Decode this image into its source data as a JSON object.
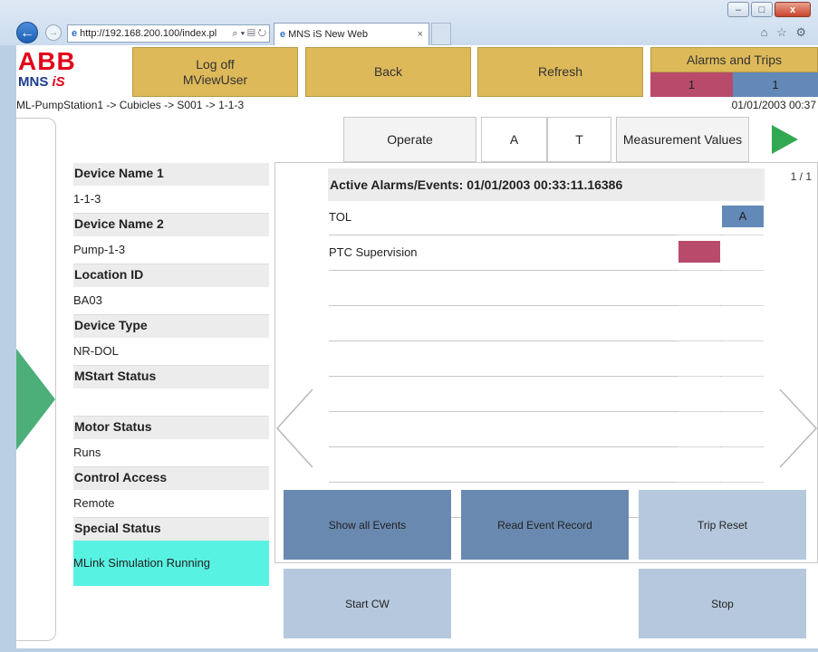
{
  "browser": {
    "address": "http://192.168.200.100/index.pl",
    "address_tools": "⌕ ▾ ▤ ↻",
    "tab_title": "MNS iS New Web",
    "tab_close": "×",
    "ie_glyph": "e",
    "back_glyph": "←",
    "forward_glyph": "→",
    "window_buttons": [
      "–",
      "□",
      "x"
    ],
    "toolbar_icons": "⌂ ☆ ⚙"
  },
  "logo": {
    "brand": "ABB",
    "product_main": "MNS ",
    "product_accent": "iS"
  },
  "header": {
    "logoff_line1": "Log off",
    "logoff_line2": "MViewUser",
    "back": "Back",
    "refresh": "Refresh",
    "alarms_title": "Alarms and Trips",
    "alarm_count": "1",
    "trip_count": "1"
  },
  "breadcrumb": "ML-PumpStation1 -> Cubicles -> S001 -> 1-1-3",
  "datetime": "01/01/2003 00:37",
  "tabs": {
    "operate": "Operate",
    "a": "A",
    "t": "T",
    "measurement": "Measurement Values"
  },
  "device_info": [
    {
      "label": "Device Name 1",
      "value": "1-1-3"
    },
    {
      "label": "Device Name 2",
      "value": "Pump-1-3"
    },
    {
      "label": "Location ID",
      "value": "BA03"
    },
    {
      "label": "Device Type",
      "value": "NR-DOL"
    },
    {
      "label": "MStart Status",
      "value": ""
    },
    {
      "label": "Motor Status",
      "value": "Runs"
    },
    {
      "label": "Control Access",
      "value": "Remote"
    },
    {
      "label": "Special Status",
      "value": "MLink Simulation Running"
    }
  ],
  "alarms": {
    "header": "Active Alarms/Events: 01/01/2003 00:33:11.16386",
    "page": "1 / 1",
    "rows": [
      {
        "text": "TOL",
        "flag": "A"
      },
      {
        "text": "PTC Supervision",
        "flag": ""
      }
    ]
  },
  "actions": {
    "show_all": "Show all Events",
    "read_record": "Read Event Record",
    "trip_reset": "Trip Reset",
    "start_cw": "Start CW",
    "stop": "Stop"
  },
  "colors": {
    "header_button": "#ddb95a",
    "alarm_red": "#b84b6c",
    "alarm_blue": "#6289b8",
    "nav_green": "#4caf7a",
    "special_status": "#58f2e2",
    "action_dark": "#6a89b0",
    "action_light": "#b5c8dd"
  }
}
